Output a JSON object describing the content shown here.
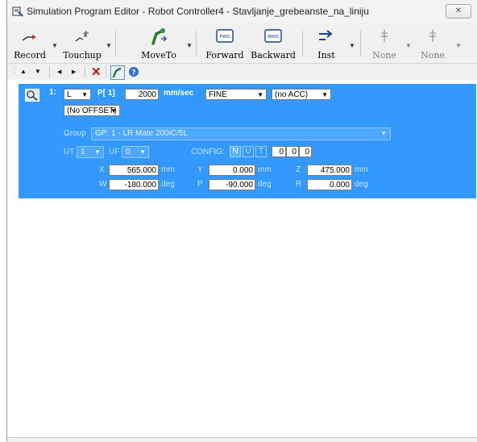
{
  "window": {
    "title": "Simulation Program Editor - Robot Controller4 - Stavljanje_grebeanste_na_liniju",
    "close_label": "✕"
  },
  "toolbar": {
    "record": "Record",
    "touchup": "Touchup",
    "moveto": "MoveTo",
    "forward": "Forward",
    "backward": "Backward",
    "inst": "Inst",
    "none1": "None",
    "none2": "None",
    "fwd_icon_text": "FWD",
    "bwd_icon_text": "BWD"
  },
  "toolbar2": {
    "up": "▲",
    "down": "▼",
    "left": "◀",
    "right": "▶",
    "delete": "✕"
  },
  "instruction": {
    "line_number": "1:",
    "motion_type": "L",
    "position": "P[ 1]",
    "speed": "2000",
    "speed_unit": "mm/sec",
    "termination": "FINE",
    "acc": "(no ACC)",
    "offset": "(No OFFSET)"
  },
  "group": {
    "label": "Group",
    "value": "GP: 1 - LR Mate 200iC/5L"
  },
  "frames": {
    "ut_label": "UT",
    "ut_value": "1",
    "uf_label": "UF",
    "uf_value": "0",
    "config_label": "CONFIG:",
    "config_flags": [
      "N",
      "U",
      "T"
    ],
    "config_turns": [
      "0",
      "0",
      "0"
    ]
  },
  "pose": {
    "x_label": "X",
    "x_value": "565.000",
    "x_unit": "mm",
    "y_label": "Y",
    "y_value": "0.000",
    "y_unit": "mm",
    "z_label": "Z",
    "z_value": "475.000",
    "z_unit": "mm",
    "w_label": "W",
    "w_value": "-180.000",
    "w_unit": "deg",
    "p_label": "P",
    "p_value": "-90.000",
    "p_unit": "deg",
    "r_label": "R",
    "r_value": "0.000",
    "r_unit": "deg"
  },
  "colors": {
    "panel_blue": "#3399ff",
    "toolbar_gray": "#f0f0f0"
  }
}
